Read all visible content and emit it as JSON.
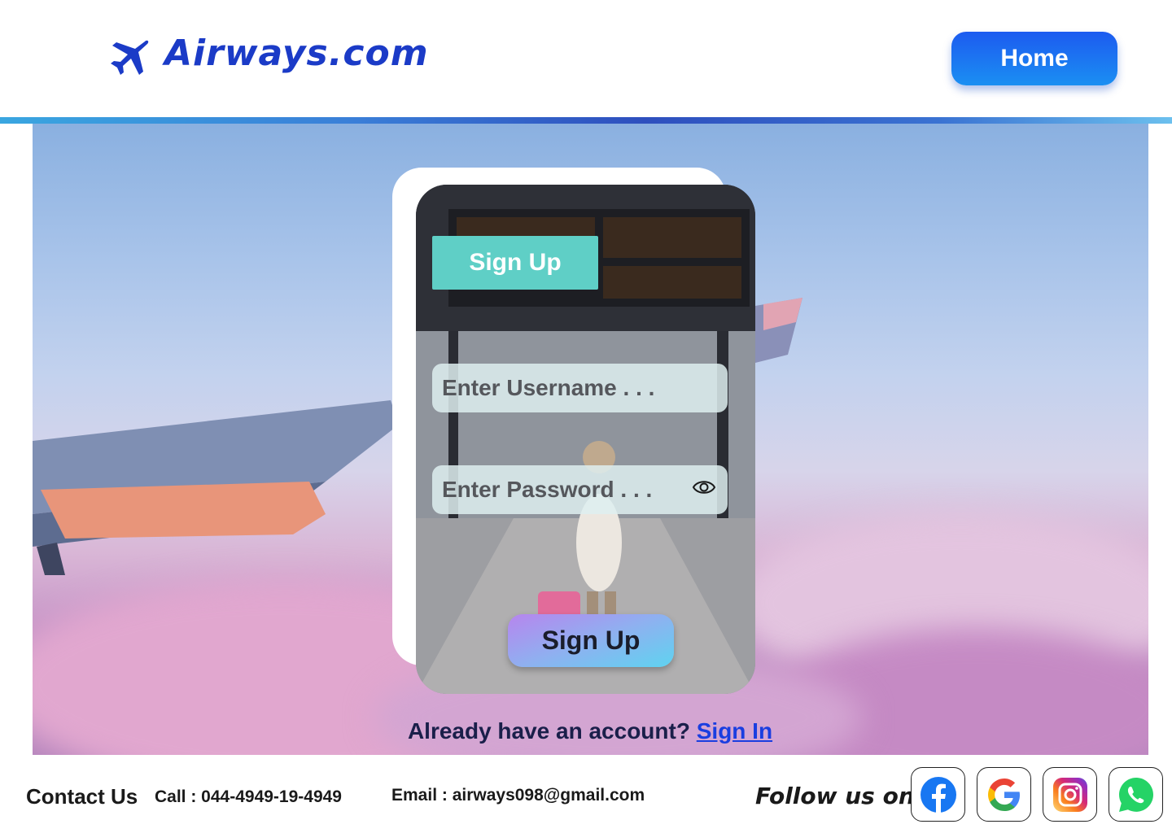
{
  "header": {
    "brand": "Airways.com",
    "home_label": "Home"
  },
  "signup_card": {
    "tag_label": "Sign Up",
    "username_placeholder": "Enter Username . . .",
    "password_placeholder": "Enter Password . . .",
    "submit_label": "Sign Up"
  },
  "signin_prompt": {
    "text": "Already have an account? ",
    "link_label": "Sign In"
  },
  "footer": {
    "contact_label": "Contact Us",
    "call": "Call : 044-4949-19-4949",
    "email": "Email : airways098@gmail.com",
    "follow_label": "Follow us on",
    "socials": [
      "facebook-icon",
      "google-icon",
      "instagram-icon",
      "whatsapp-icon"
    ]
  },
  "colors": {
    "brand": "#1b3bc7",
    "home_button": "#1c5bf0",
    "signup_tag": "#5fcfc6",
    "link": "#1a3ee0"
  }
}
